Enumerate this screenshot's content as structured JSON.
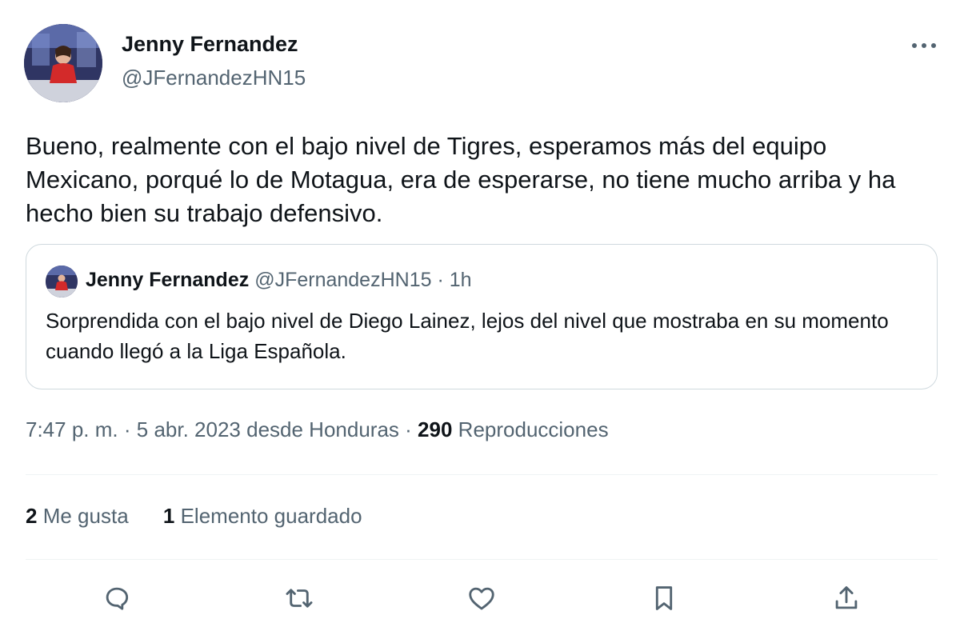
{
  "author": {
    "name": "Jenny Fernandez",
    "handle": "@JFernandezHN15"
  },
  "tweet": {
    "text": "Bueno, realmente con el bajo nivel de Tigres, esperamos más del equipo Mexicano, porqué lo de Motagua, era de esperarse, no tiene mucho arriba y ha hecho bien su trabajo defensivo."
  },
  "quote": {
    "name": "Jenny Fernandez",
    "handle": "@JFernandezHN15",
    "separator": "·",
    "time": "1h",
    "text": "Sorprendida con el bajo nivel de Diego Lainez, lejos del nivel que mostraba en su momento cuando llegó a la Liga Española."
  },
  "meta": {
    "time": "7:47 p. m.",
    "separator": "·",
    "date_location": "5 abr. 2023 desde Honduras",
    "views_count": "290",
    "views_label": "Reproducciones"
  },
  "stats": {
    "likes_count": "2",
    "likes_label": "Me gusta",
    "bookmarks_count": "1",
    "bookmarks_label": "Elemento guardado"
  },
  "icons": {
    "more": "more-horizontal-icon",
    "reply": "reply-icon",
    "retweet": "retweet-icon",
    "like": "heart-icon",
    "bookmark": "bookmark-icon",
    "share": "share-icon"
  },
  "colors": {
    "text_primary": "#0f1419",
    "text_secondary": "#536471",
    "border": "#cfd9de",
    "divider": "#eff3f4"
  }
}
